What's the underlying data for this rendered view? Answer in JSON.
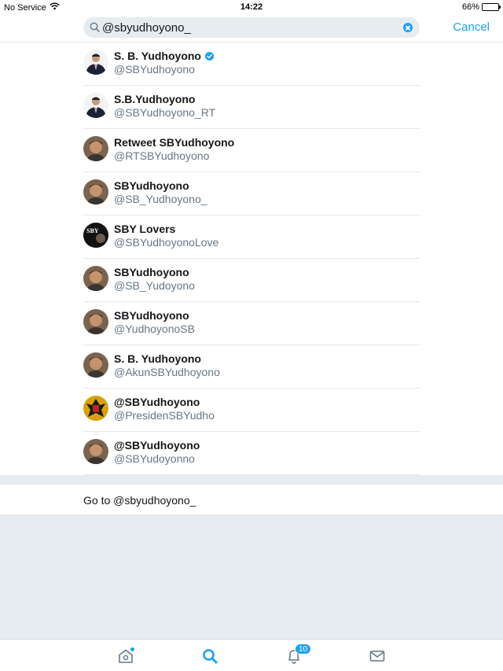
{
  "status_bar": {
    "carrier": "No Service",
    "time": "14:22",
    "battery": "66%",
    "battery_level": 0.66
  },
  "search": {
    "query": "@sbyudhoyono_",
    "cancel_label": "Cancel"
  },
  "results": [
    {
      "name": "S. B. Yudhoyono",
      "handle": "@SBYudhoyono",
      "verified": true,
      "avatar_icon": "suit-portrait-avatar"
    },
    {
      "name": "S.B.Yudhoyono",
      "handle": "@SBYudhoyono_RT",
      "verified": false,
      "avatar_icon": "suit-portrait-avatar"
    },
    {
      "name": "Retweet SBYudhoyono",
      "handle": "@RTSBYudhoyono",
      "verified": false,
      "avatar_icon": "face-portrait-avatar"
    },
    {
      "name": "SBYudhoyono",
      "handle": "@SB_Yudhoyono_",
      "verified": false,
      "avatar_icon": "face-portrait-avatar"
    },
    {
      "name": "SBY Lovers",
      "handle": "@SBYudhoyonoLove",
      "verified": false,
      "avatar_icon": "sby-text-avatar",
      "avatar_text": "SBY"
    },
    {
      "name": "SBYudhoyono",
      "handle": "@SB_Yudoyono",
      "verified": false,
      "avatar_icon": "face-portrait-avatar"
    },
    {
      "name": "SBYudhoyono",
      "handle": "@YudhoyonoSB",
      "verified": false,
      "avatar_icon": "face-portrait-avatar"
    },
    {
      "name": "S. B. Yudhoyono",
      "handle": "@AkunSBYudhoyono",
      "verified": false,
      "avatar_icon": "face-portrait-avatar"
    },
    {
      "name": "@SBYudhoyono",
      "handle": "@PresidenSBYudho",
      "verified": false,
      "avatar_icon": "garuda-emblem-avatar"
    },
    {
      "name": "@SBYudhoyono",
      "handle": "@SBYudoyonno",
      "verified": false,
      "avatar_icon": "face-portrait-avatar"
    }
  ],
  "goto": {
    "label": "Go to @sbyudhoyono_"
  },
  "tab_bar": {
    "tabs": [
      {
        "name": "home",
        "icon": "home-icon"
      },
      {
        "name": "search",
        "icon": "search-icon"
      },
      {
        "name": "notifications",
        "icon": "bell-icon",
        "badge": "10"
      },
      {
        "name": "messages",
        "icon": "mail-icon"
      }
    ]
  },
  "colors": {
    "accent": "#1da1f2",
    "background": "#e6ecf0",
    "text_primary": "#14171a",
    "text_secondary": "#657786"
  }
}
